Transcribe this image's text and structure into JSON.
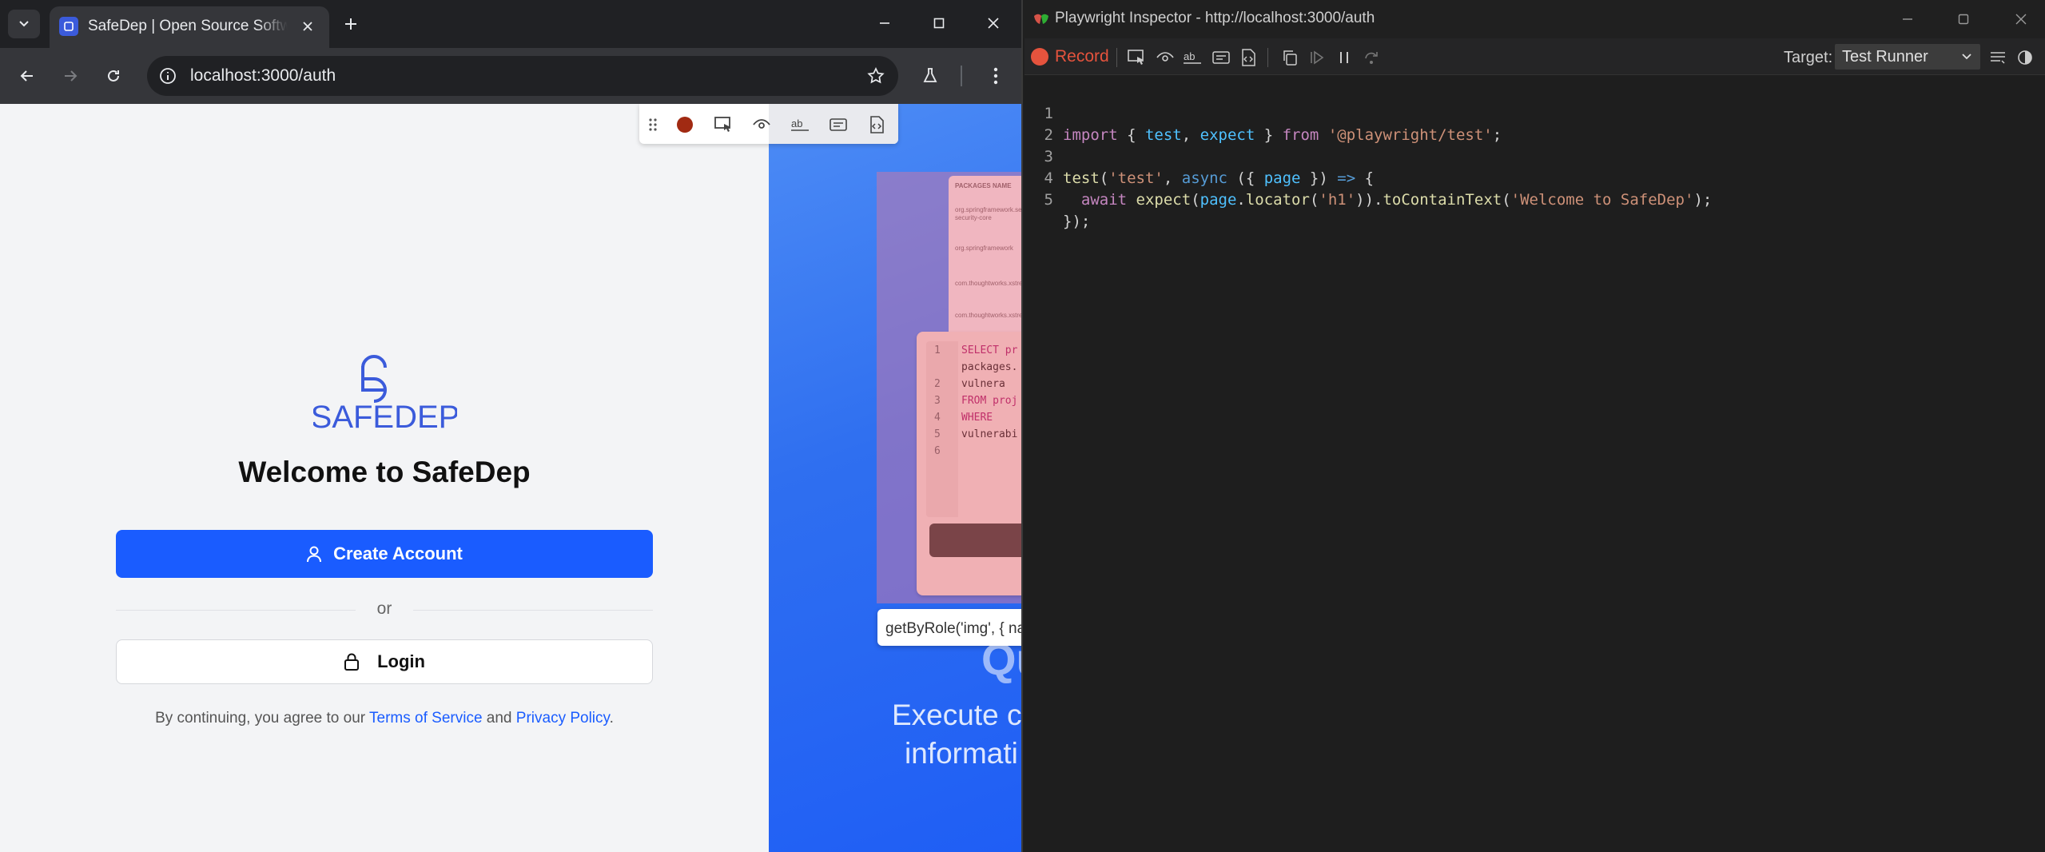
{
  "browser": {
    "tab_title": "SafeDep | Open Source Software Security",
    "url": "localhost:3000/auth"
  },
  "auth": {
    "logo_text": "SAFEDEP",
    "heading": "Welcome to SafeDep",
    "create_account_label": "Create Account",
    "or_text": "or",
    "login_label": "Login",
    "terms_prefix": "By continuing, you agree to our ",
    "terms_link": "Terms of Service",
    "terms_middle": " and ",
    "privacy_link": "Privacy Policy",
    "terms_suffix": "."
  },
  "hero": {
    "table_header": "PACKAGES NAME",
    "table_rows": [
      "org.springframework.security:spring-security-core",
      "org.springframework",
      "com.thoughtworks.xstream",
      "com.thoughtworks.xstream"
    ],
    "sql_lines": [
      {
        "num": "1",
        "code": "SELECT pr"
      },
      {
        "num": "",
        "code": "packages."
      },
      {
        "num": "2",
        "code": "  vulnera"
      },
      {
        "num": "3",
        "code": "FROM proj"
      },
      {
        "num": "4",
        "code": "  WHERE"
      },
      {
        "num": "5",
        "code": "vulnerabi"
      },
      {
        "num": "6",
        "code": ""
      }
    ],
    "locator_tooltip": "getByRole('img', { name",
    "heading_partial": "Qu",
    "desc_line1": "Execute c",
    "desc_line2": "informati"
  },
  "inspector": {
    "window_title": "Playwright Inspector - http://localhost:3000/auth",
    "record_label": "Record",
    "target_label": "Target:",
    "target_value": "Test Runner",
    "code_lines": [
      "import { test, expect } from '@playwright/test';",
      "",
      "test('test', async ({ page }) => {",
      "  await expect(page.locator('h1')).toContainText('Welcome to SafeDep');",
      "});"
    ]
  },
  "colors": {
    "primary_blue": "#1a5cff",
    "record_red": "#e5533d",
    "hero_blue": "#2f6ff0"
  }
}
